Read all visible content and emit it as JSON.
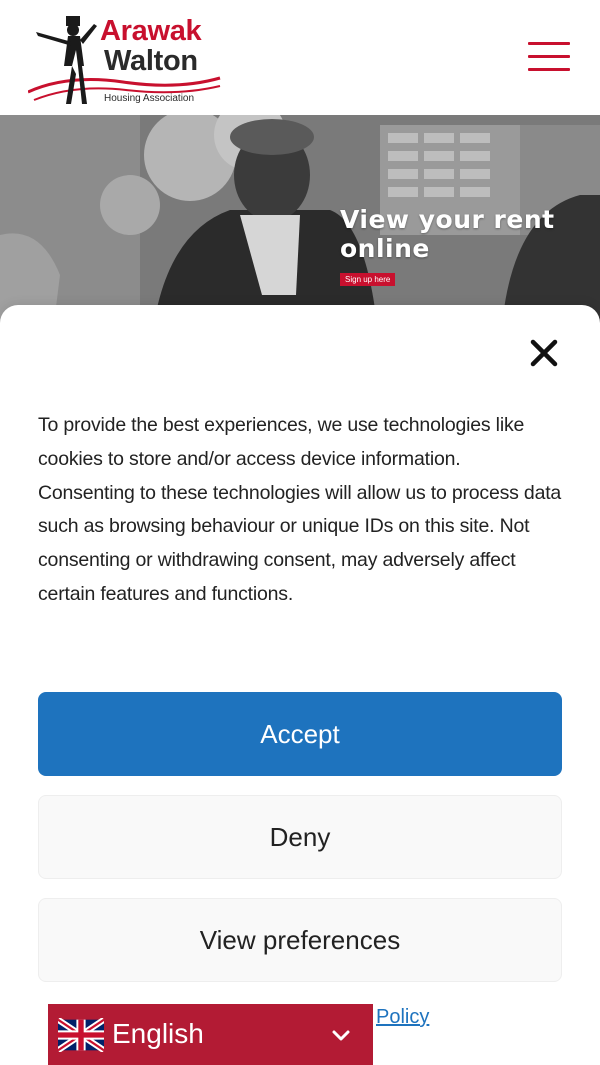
{
  "header": {
    "logo": {
      "name_line1": "Arawak",
      "name_line2": "Walton",
      "tagline": "Housing Association"
    },
    "menu_icon": "hamburger-menu-icon"
  },
  "hero": {
    "title": "View your rent online",
    "cta_label": "Sign up here"
  },
  "cookie_consent": {
    "close_icon": "close-icon",
    "body_text": "To provide the best experiences, we use technologies like cookies to store and/or access device information. Consenting to these technologies will allow us to process data such as browsing behaviour or unique IDs on this site. Not consenting or withdrawing consent, may adversely affect certain features and functions.",
    "accept_label": "Accept",
    "deny_label": "Deny",
    "preferences_label": "View preferences",
    "policy_link_label": "Policy"
  },
  "language_selector": {
    "flag_icon": "uk-flag-icon",
    "selected_language": "English",
    "chevron_icon": "chevron-down-icon"
  },
  "colors": {
    "brand_red": "#c8102e",
    "accept_blue": "#1e73be",
    "language_bar": "#b31b34"
  }
}
